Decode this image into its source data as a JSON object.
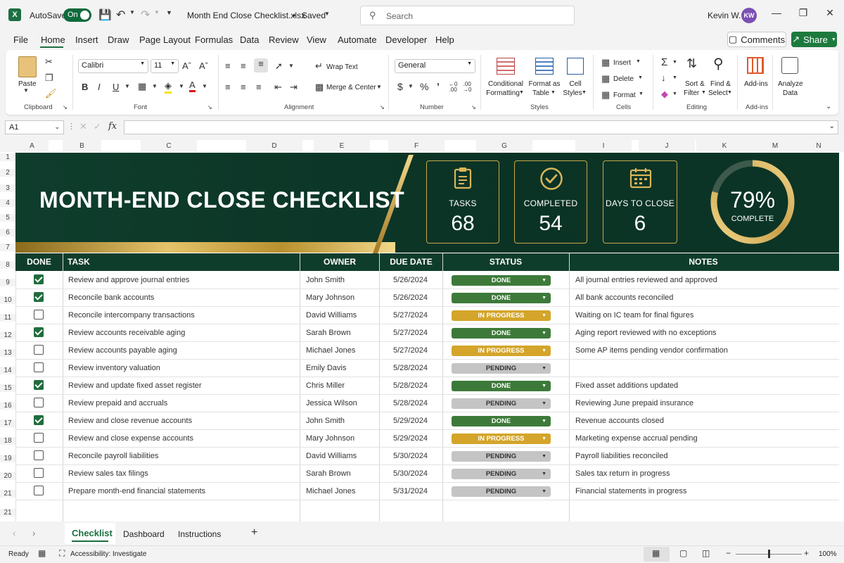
{
  "titlebar": {
    "autosave_label": "AutoSave",
    "autosave_state": "On",
    "filename": "Month End Close Checklist.xlsx",
    "saved_state": "Saved",
    "search_placeholder": "Search",
    "user_name": "Kevin W.",
    "user_initials": "KW"
  },
  "menu": {
    "items": [
      "File",
      "Home",
      "Insert",
      "Draw",
      "Page Layout",
      "Formulas",
      "Data",
      "Review",
      "View",
      "Automate",
      "Developer",
      "Help"
    ],
    "active": "Home",
    "comments_label": "Comments",
    "share_label": "Share"
  },
  "ribbon": {
    "clipboard": {
      "paste": "Paste",
      "label": "Clipboard"
    },
    "font": {
      "name": "Calibri",
      "size": "11",
      "label": "Font"
    },
    "alignment": {
      "wrap": "Wrap Text",
      "merge": "Merge & Center",
      "label": "Alignment"
    },
    "number": {
      "format": "General",
      "label": "Number"
    },
    "styles": {
      "conditional": [
        "Conditional",
        "Formatting"
      ],
      "format_table": [
        "Format as",
        "Table"
      ],
      "cell_styles": [
        "Cell",
        "Styles"
      ],
      "label": "Styles"
    },
    "cells": {
      "insert": "Insert",
      "delete": "Delete",
      "format": "Format",
      "label": "Cells"
    },
    "editing": {
      "sort": [
        "Sort &",
        "Filter"
      ],
      "find": [
        "Find &",
        "Select"
      ],
      "label": "Editing"
    },
    "addins": {
      "addins": "Add-ins",
      "label": "Add-ins"
    },
    "analyze": {
      "label": [
        "Analyze",
        "Data"
      ]
    }
  },
  "formula_bar": {
    "name_box": "A1",
    "fx": "fx",
    "value": ""
  },
  "columns": [
    "A",
    "B",
    "C",
    "D",
    "E",
    "F",
    "G",
    "I",
    "J",
    "K",
    "M",
    "N"
  ],
  "rows": [
    "1",
    "2",
    "3",
    "4",
    "5",
    "6",
    "7",
    "8",
    "9",
    "10",
    "11",
    "12",
    "13",
    "14",
    "15",
    "16",
    "17",
    "18",
    "19",
    "20",
    "21",
    "21"
  ],
  "banner": {
    "title": "MONTH-END CLOSE CHECKLIST",
    "kpis": [
      {
        "label": "TASKS",
        "value": "68",
        "icon": "clipboard-icon"
      },
      {
        "label": "COMPLETED",
        "value": "54",
        "icon": "check-circle-icon"
      },
      {
        "label": "DAYS TO CLOSE",
        "value": "6",
        "icon": "calendar-icon"
      }
    ],
    "progress": {
      "value_text": "79%",
      "label": "COMPLETE",
      "fraction": 0.79
    }
  },
  "table": {
    "headers": {
      "done": "DONE",
      "task": "TASK",
      "owner": "OWNER",
      "due": "DUE DATE",
      "status": "STATUS",
      "notes": "NOTES"
    },
    "rows": [
      {
        "done": true,
        "task": "Review and approve journal entries",
        "owner": "John Smith",
        "due": "5/26/2024",
        "status": "DONE",
        "notes": "All journal entries reviewed and approved"
      },
      {
        "done": true,
        "task": "Reconcile bank accounts",
        "owner": "Mary Johnson",
        "due": "5/26/2024",
        "status": "DONE",
        "notes": "All bank accounts reconciled"
      },
      {
        "done": false,
        "task": "Reconcile intercompany transactions",
        "owner": "David Williams",
        "due": "5/27/2024",
        "status": "IN PROGRESS",
        "notes": "Waiting on IC team for final figures"
      },
      {
        "done": true,
        "task": "Review accounts receivable aging",
        "owner": "Sarah Brown",
        "due": "5/27/2024",
        "status": "DONE",
        "notes": "Aging report reviewed with no exceptions"
      },
      {
        "done": false,
        "task": "Review accounts payable aging",
        "owner": "Michael Jones",
        "due": "5/27/2024",
        "status": "IN PROGRESS",
        "notes": "Some AP items pending vendor confirmation"
      },
      {
        "done": false,
        "task": "Review inventory valuation",
        "owner": "Emily Davis",
        "due": "5/28/2024",
        "status": "PENDING",
        "notes": ""
      },
      {
        "done": true,
        "task": "Review and update fixed asset register",
        "owner": "Chris Miller",
        "due": "5/28/2024",
        "status": "DONE",
        "notes": "Fixed asset additions updated"
      },
      {
        "done": false,
        "task": "Review prepaid and accruals",
        "owner": "Jessica Wilson",
        "due": "5/28/2024",
        "status": "PENDING",
        "notes": "Reviewing June prepaid insurance"
      },
      {
        "done": true,
        "task": "Review and close revenue accounts",
        "owner": "John Smith",
        "due": "5/29/2024",
        "status": "DONE",
        "notes": "Revenue accounts closed"
      },
      {
        "done": false,
        "task": "Review and close expense accounts",
        "owner": "Mary Johnson",
        "due": "5/29/2024",
        "status": "IN PROGRESS",
        "notes": "Marketing expense accrual pending"
      },
      {
        "done": false,
        "task": "Reconcile payroll liabilities",
        "owner": "David Williams",
        "due": "5/30/2024",
        "status": "PENDING",
        "notes": "Payroll liabilities reconciled"
      },
      {
        "done": false,
        "task": "Review sales tax filings",
        "owner": "Sarah Brown",
        "due": "5/30/2024",
        "status": "PENDING",
        "notes": "Sales tax return in progress"
      },
      {
        "done": false,
        "task": "Prepare month-end financial statements",
        "owner": "Michael Jones",
        "due": "5/31/2024",
        "status": "PENDING",
        "notes": "Financial statements in progress"
      }
    ]
  },
  "status_colors": {
    "DONE": "#3d7a3a",
    "IN PROGRESS": "#d4a52a",
    "PENDING": "#c4c4c4"
  },
  "sheets": {
    "tabs": [
      "Checklist",
      "Dashboard",
      "Instructions"
    ],
    "active": "Checklist"
  },
  "statusbar": {
    "ready": "Ready",
    "accessibility": "Accessibility: Investigate",
    "zoom": "100%"
  }
}
